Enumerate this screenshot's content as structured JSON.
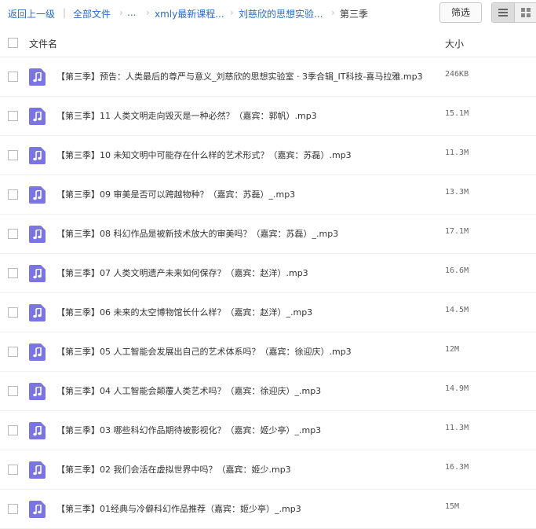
{
  "breadcrumb": {
    "back": "返回上一级",
    "sep": "|",
    "all_files": "全部文件",
    "arrow": "›",
    "ellipsis": "...",
    "folder1": "xmly最新课程...",
    "folder2": "刘慈欣的思想实验...",
    "current": "第三季"
  },
  "toolbar": {
    "filter_label": "筛选"
  },
  "table": {
    "col_name": "文件名",
    "col_size": "大小"
  },
  "files": [
    {
      "name": "【第三季】预告：人类最后的尊严与意义_刘慈欣的思想实验室 · 3季合辑_IT科技-喜马拉雅.mp3",
      "size": "246KB"
    },
    {
      "name": "【第三季】11 人类文明走向毁灭是一种必然？（嘉宾：郭帆）.mp3",
      "size": "15.1M"
    },
    {
      "name": "【第三季】10 未知文明中可能存在什么样的艺术形式？（嘉宾：苏磊）.mp3",
      "size": "11.3M"
    },
    {
      "name": "【第三季】09 审美是否可以跨越物种？（嘉宾：苏磊）_.mp3",
      "size": "13.3M"
    },
    {
      "name": "【第三季】08 科幻作品是被新技术放大的审美吗？（嘉宾：苏磊）_.mp3",
      "size": "17.1M"
    },
    {
      "name": "【第三季】07 人类文明遗产未来如何保存？（嘉宾：赵洋）.mp3",
      "size": "16.6M"
    },
    {
      "name": "【第三季】06 未来的太空博物馆长什么样？（嘉宾：赵洋）_.mp3",
      "size": "14.5M"
    },
    {
      "name": "【第三季】05 人工智能会发展出自己的艺术体系吗？（嘉宾：徐迎庆）.mp3",
      "size": "12M"
    },
    {
      "name": "【第三季】04 人工智能会颠覆人类艺术吗？（嘉宾：徐迎庆）_.mp3",
      "size": "14.9M"
    },
    {
      "name": "【第三季】03 哪些科幻作品期待被影视化？（嘉宾：姬少亭）_.mp3",
      "size": "11.3M"
    },
    {
      "name": "【第三季】02 我们会活在虚拟世界中吗？（嘉宾：姬少.mp3",
      "size": "16.3M"
    },
    {
      "name": "【第三季】01经典与冷僻科幻作品推荐（嘉宾：姬少亭）_.mp3",
      "size": "15M"
    }
  ],
  "icons": {
    "file": "audio-file-icon",
    "list_view": "list-view-icon",
    "grid_view": "grid-view-icon"
  },
  "colors": {
    "link": "#2b6cc4",
    "audio_icon": "#7b75e4"
  }
}
